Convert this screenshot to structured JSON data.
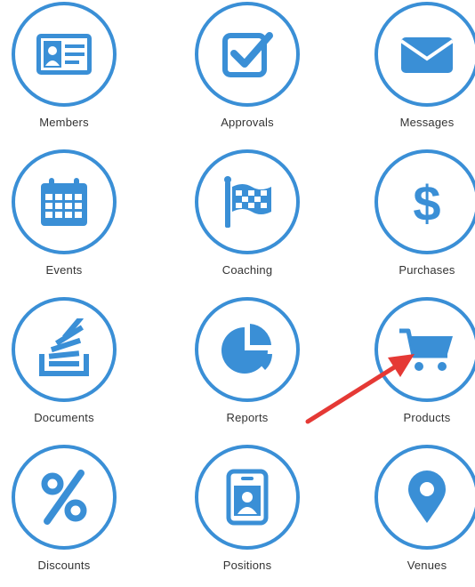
{
  "tiles": [
    {
      "label": "Members",
      "icon": "id-card-icon"
    },
    {
      "label": "Approvals",
      "icon": "checkbox-icon"
    },
    {
      "label": "Messages",
      "icon": "envelope-icon"
    },
    {
      "label": "Events",
      "icon": "calendar-icon"
    },
    {
      "label": "Coaching",
      "icon": "checkered-flag-icon"
    },
    {
      "label": "Purchases",
      "icon": "dollar-icon"
    },
    {
      "label": "Documents",
      "icon": "document-stack-icon"
    },
    {
      "label": "Reports",
      "icon": "pie-chart-icon"
    },
    {
      "label": "Products",
      "icon": "shopping-cart-icon"
    },
    {
      "label": "Discounts",
      "icon": "percent-icon"
    },
    {
      "label": "Positions",
      "icon": "badge-icon"
    },
    {
      "label": "Venues",
      "icon": "map-pin-icon"
    }
  ],
  "colors": {
    "accent": "#3a8fd6",
    "arrow": "#e53935"
  }
}
